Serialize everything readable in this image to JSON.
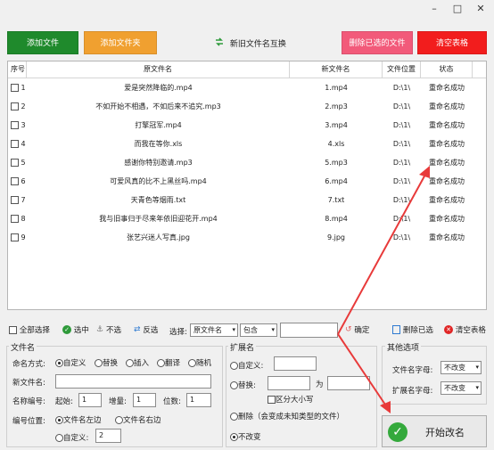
{
  "window_controls": {
    "minimize": "–",
    "maximize": "□",
    "close": "✕"
  },
  "toolbar": {
    "add_file": "添加文件",
    "add_folder": "添加文件夹",
    "swap_names": "新旧文件名互换",
    "delete_selected": "删除已选的文件",
    "clear_table": "清空表格"
  },
  "table": {
    "headers": [
      "序号",
      "原文件名",
      "新文件名",
      "文件位置",
      "状态"
    ],
    "rows": [
      {
        "num": "1",
        "orig": "爱是突然降临的.mp4",
        "new": "1.mp4",
        "loc": "D:\\1\\",
        "status": "重命名成功"
      },
      {
        "num": "2",
        "orig": "不如开始不相遇，不如后来不追究.mp3",
        "new": "2.mp3",
        "loc": "D:\\1\\",
        "status": "重命名成功"
      },
      {
        "num": "3",
        "orig": "打擎冠军.mp4",
        "new": "3.mp4",
        "loc": "D:\\1\\",
        "status": "重命名成功"
      },
      {
        "num": "4",
        "orig": "而我在等你.xls",
        "new": "4.xls",
        "loc": "D:\\1\\",
        "status": "重命名成功"
      },
      {
        "num": "5",
        "orig": "感谢你特别邀请.mp3",
        "new": "5.mp3",
        "loc": "D:\\1\\",
        "status": "重命名成功"
      },
      {
        "num": "6",
        "orig": "可爱风真的比不上黑丝吗.mp4",
        "new": "6.mp4",
        "loc": "D:\\1\\",
        "status": "重命名成功"
      },
      {
        "num": "7",
        "orig": "天青色等烟雨.txt",
        "new": "7.txt",
        "loc": "D:\\1\\",
        "status": "重命名成功"
      },
      {
        "num": "8",
        "orig": "我与旧事归于尽来年依旧迎花开.mp4",
        "new": "8.mp4",
        "loc": "D:\\1\\",
        "status": "重命名成功"
      },
      {
        "num": "9",
        "orig": "张艺兴迷人写真.jpg",
        "new": "9.jpg",
        "loc": "D:\\1\\",
        "status": "重命名成功"
      }
    ]
  },
  "selection_bar": {
    "select_all": "全部选择",
    "select": "选中",
    "deselect": "不选",
    "invert": "反选",
    "choose": "选择:",
    "field_value": "原文件名",
    "match_value": "包含",
    "confirm": "确定",
    "delete_selected": "删除已选",
    "clear_table": "清空表格"
  },
  "filename_panel": {
    "title": "文件名",
    "mode_label": "命名方式:",
    "modes": [
      "自定义",
      "替换",
      "插入",
      "翻译",
      "随机"
    ],
    "new_name_label": "新文件名:",
    "numbering_label": "名称编号:",
    "start_label": "起始:",
    "start_value": "1",
    "step_label": "增量:",
    "step_value": "1",
    "digits_label": "位数:",
    "digits_value": "1",
    "position_label": "编号位置:",
    "pos_left": "文件名左边",
    "pos_right": "文件名右边",
    "pos_custom": "自定义:",
    "pos_custom_value": "2"
  },
  "ext_panel": {
    "title": "扩展名",
    "custom": "自定义:",
    "replace": "替换:",
    "to": "为",
    "case_sensitive": "区分大小写",
    "delete": "删除（会变成未知类型的文件）",
    "unchanged": "不改变"
  },
  "other_panel": {
    "title": "其他选项",
    "fname_case_label": "文件名字母:",
    "fname_case_value": "不改变",
    "ext_case_label": "扩展名字母:",
    "ext_case_value": "不改变"
  },
  "start_button": "开始改名",
  "colors": {
    "green": "#1f8a2c",
    "orange": "#f0a030",
    "pink": "#f25a7a",
    "red": "#f21d1d",
    "arrow": "#e83a3a"
  }
}
